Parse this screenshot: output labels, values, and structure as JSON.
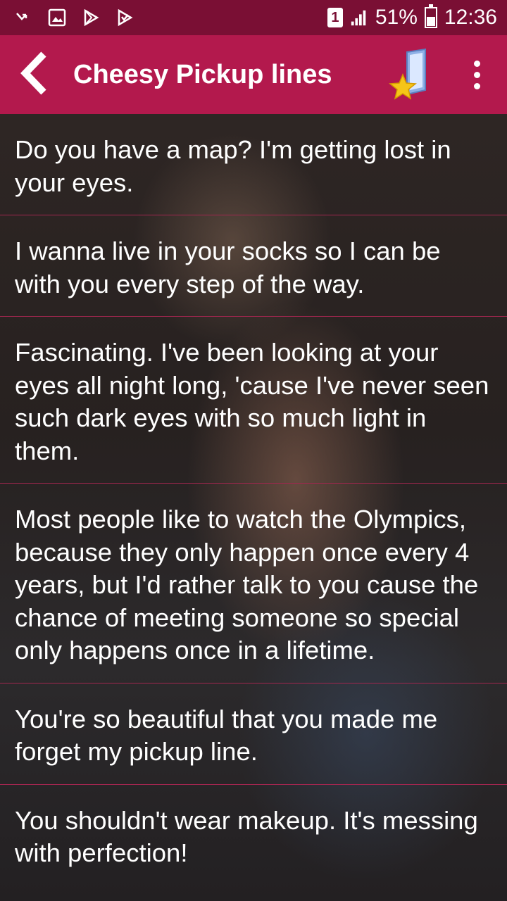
{
  "status_bar": {
    "sim_label": "1",
    "battery_percent": "51%",
    "time": "12:36",
    "icons": [
      "missed-call-icon",
      "gallery-icon",
      "play-store-icon",
      "play-store-download-icon",
      "signal-icon",
      "battery-icon"
    ]
  },
  "app_bar": {
    "title": "Cheesy Pickup lines",
    "back_icon": "back-chevron-icon",
    "favorite_icon": "favorites-star-icon",
    "menu_icon": "overflow-menu-icon"
  },
  "colors": {
    "status_bar": "#7a0f34",
    "app_bar": "#b3194d",
    "divider": "#a2264f",
    "text": "#ffffff"
  },
  "lines": [
    "Do you have a map? I'm getting lost in your eyes.",
    "I wanna live in your socks so I can be with you every step of the way.",
    "Fascinating. I've been looking at your eyes all night long, 'cause I've never seen such dark eyes with so much light in them.",
    "Most people like to watch the Olympics, because they only happen once every 4 years, but I'd rather talk to you cause the chance of meeting someone so special only happens once in a lifetime.",
    "You're so beautiful that you made me forget my pickup line.",
    "You shouldn't wear makeup. It's messing with perfection!"
  ]
}
